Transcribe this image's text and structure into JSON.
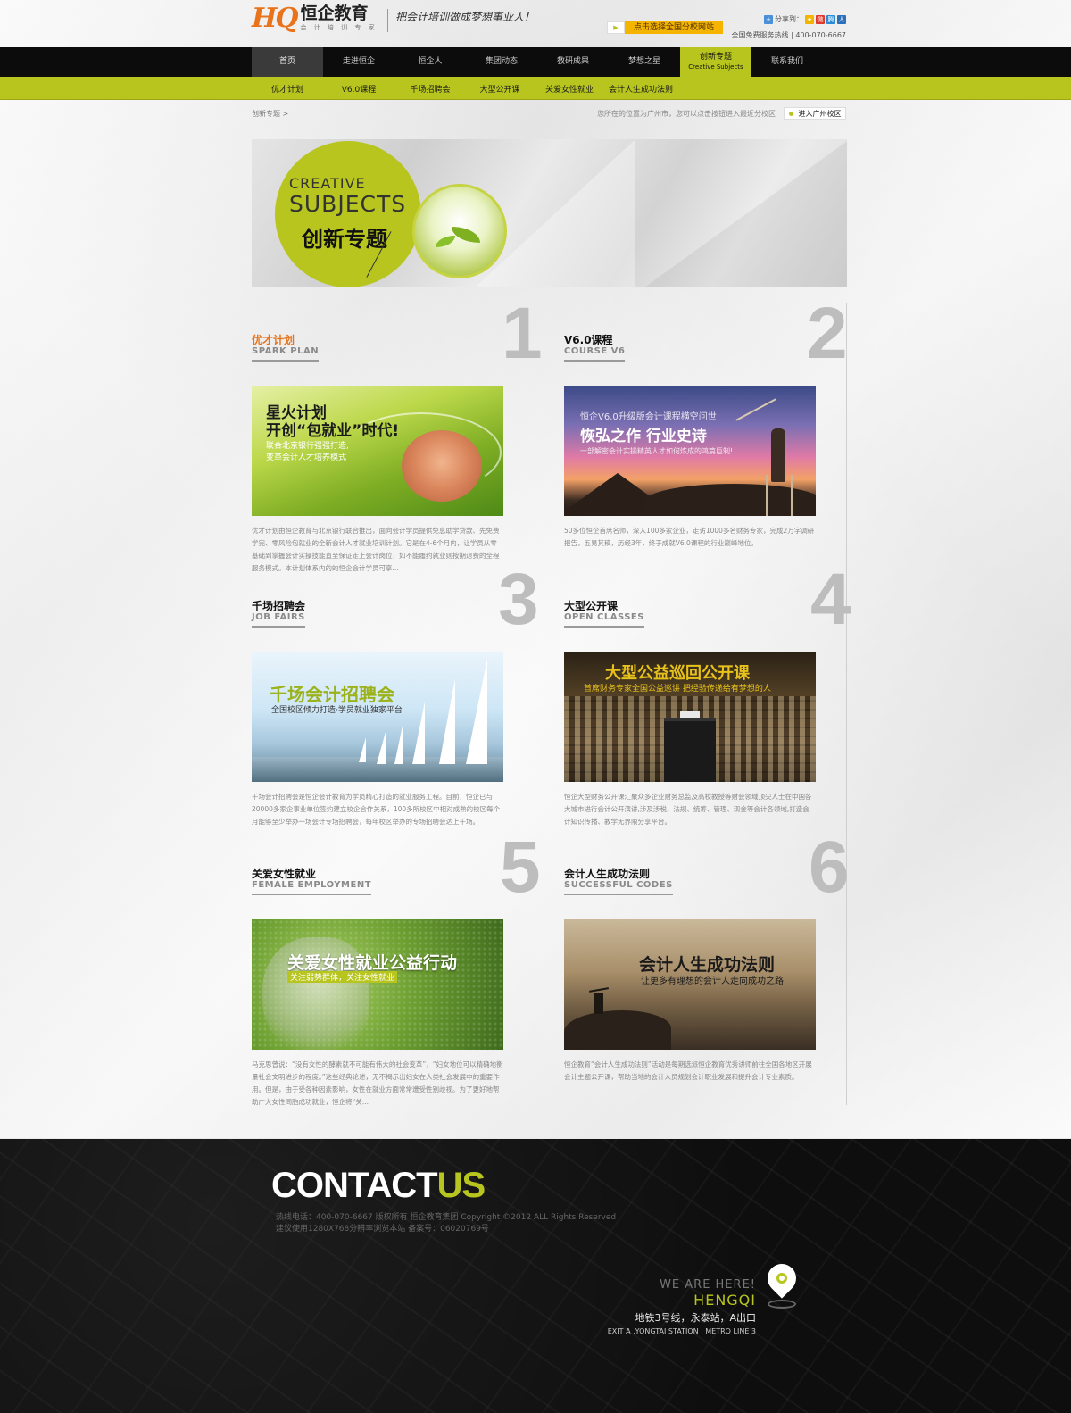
{
  "header": {
    "logo_mark": "HQ",
    "logo_name": "恒企教育",
    "logo_tagline": "会 计 培 训 专 家",
    "slogan": "把会计培训做成梦想事业人！",
    "branch_button": "点击选择全国分校网站",
    "share_label": "分享到：",
    "hotline": "全国免费服务热线 | 400-070-6667",
    "share_icons": [
      "qzone-icon",
      "weibo-icon",
      "tencent-icon",
      "renren-icon"
    ]
  },
  "nav": {
    "items": [
      {
        "label": "首页",
        "en": ""
      },
      {
        "label": "走进恒企",
        "en": ""
      },
      {
        "label": "恒企人",
        "en": ""
      },
      {
        "label": "集团动态",
        "en": ""
      },
      {
        "label": "教研成果",
        "en": ""
      },
      {
        "label": "梦想之星",
        "en": ""
      },
      {
        "label": "创新专题",
        "en": "Creative Subjects"
      },
      {
        "label": "联系我们",
        "en": ""
      }
    ]
  },
  "subnav": {
    "items": [
      "优才计划",
      "V6.0课程",
      "千场招聘会",
      "大型公开课",
      "关爱女性就业",
      "会计人生成功法则"
    ]
  },
  "breadcrumb": {
    "path": "创新专题 >",
    "location": "您所在的位置为广州市，您可以点击按钮进入最近分校区",
    "campus_button": "进入广州校区"
  },
  "banner": {
    "en_line1": "CREATIVE",
    "en_line2": "SUBJECTS",
    "cn": "创新专题"
  },
  "items": [
    {
      "num": "1",
      "title": "优才计划",
      "en": "SPARK PLAN",
      "pic_title": "星火计划",
      "pic_title2": "开创“包就业”时代!",
      "pic_sub": "联合北京银行强强打造,",
      "pic_sub2": "变革会计人才培养模式",
      "desc": "优才计划由恒企教育与北京银行联合推出，面向会计学员提供免息助学贷款、先免费学完、零风险包就业的全新会计人才就业培训计划。它是在4-6个月内，让学员从零基础到掌握会计实操技能直至保证走上会计岗位，如不能履约就业则按期退费的全程服务模式。本计划体系内的的恒企会计学员可享..."
    },
    {
      "num": "2",
      "title": "V6.0课程",
      "en": "COURSE V6",
      "pic_title": "恒企V6.0升级版会计课程横空问世",
      "pic_title2": "恢弘之作  行业史诗",
      "pic_sub": "一部解密会计实操精英人才如何炼成的鸿篇巨制!",
      "pic_sub2": "",
      "desc": "50多位恒企首席名师，深入100多家企业，走访1000多名财务专家，完成2万字调研报告，五易其稿，历经3年，终于成就V6.0课程的行业巅峰地位。"
    },
    {
      "num": "3",
      "title": "千场招聘会",
      "en": "JOB FAIRS",
      "pic_title": "千场会计招聘会",
      "pic_title2": "",
      "pic_sub": "全国校区倾力打造·学员就业独家平台",
      "pic_sub2": "",
      "desc": "千场会计招聘会是恒企会计教育为学员精心打造的就业服务工程。目前，恒企已与20000多家企事业单位签约建立校企合作关系，100多所校区中相对成熟的校区每个月能够至少举办一场会计专场招聘会，每年校区举办的专场招聘会达上千场。"
    },
    {
      "num": "4",
      "title": "大型公开课",
      "en": "OPEN CLASSES",
      "pic_title": "大型公益巡回公开课",
      "pic_title2": "",
      "pic_sub": "首席财务专家全国公益巡讲 把经验传递给有梦想的人",
      "pic_sub2": "",
      "desc": "恒企大型财务公开课汇聚众多企业财务总监及高校教授等财会领域顶尖人士在中国各大城市进行会计公开演讲,涉及涉税、法规、统筹、管理、现金等会计各领域,打造会计知识传播、教学无界限分享平台。"
    },
    {
      "num": "5",
      "title": "关爱女性就业",
      "en": "FEMALE EMPLOYMENT",
      "pic_title": "关爱女性就业公益行动",
      "pic_title2": "",
      "pic_sub": "关注弱势群体，关注女性就业",
      "pic_sub2": "",
      "desc": "马克思曾说：“没有女性的酵素就不可能有伟大的社会变革”，“妇女地位可以精确地衡量社会文明进步的程度。”这些经典论述，无不揭示出妇女在人类社会发展中的重要作用。但是，由于受各种因素影响，女性在就业方面常常遭受性别歧视。为了更好地帮助广大女性同胞成功就业，恒企将“关..."
    },
    {
      "num": "6",
      "title": "会计人生成功法则",
      "en": "SUCCESSFUL CODES",
      "pic_title": "会计人生成功法则",
      "pic_title2": "",
      "pic_sub": "让更多有理想的会计人走向成功之路",
      "pic_sub2": "",
      "desc": "恒企教育“会计人生成功法则”活动是每期选派恒企教育优秀讲师前往全国各地区开展会计主题公开课，帮助当地的会计人员规划会计职业发展和提升会计专业素质。"
    }
  ],
  "footer": {
    "contact": "CONTACT",
    "contact_us": "US",
    "copy1": "热线电话：400-070-6667 版权所有    恒企教育集团 Copyright ©2012 ALL Rights Reserved",
    "copy2": "建议使用1280X768分辨率浏览本站 备案号：06020769号",
    "we_are": "WE ARE HERE!",
    "brand": "HENGQI",
    "address_cn": "地铁3号线，永泰站，A出口",
    "address_en": "EXIT A ,YONGTAI STATION , METRO LINE 3"
  },
  "colors": {
    "accent": "#b7c51e",
    "nav_bg": "#0c0c0c",
    "orange": "#e8731a",
    "footer_bg": "#111111"
  }
}
